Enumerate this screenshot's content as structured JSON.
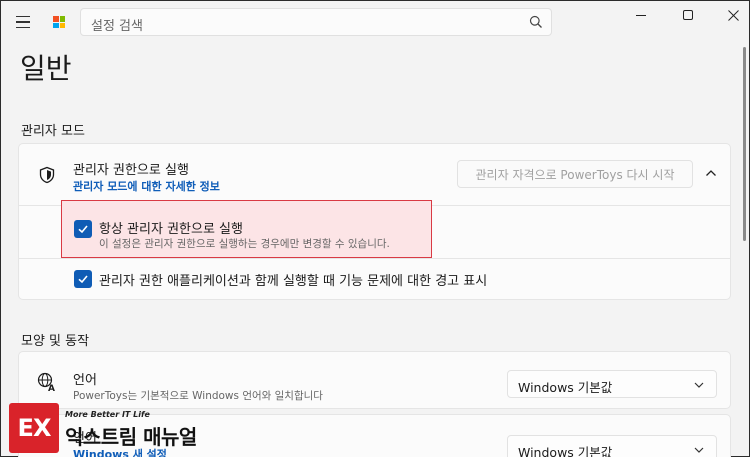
{
  "search": {
    "placeholder": "설정 검색"
  },
  "page": {
    "title": "일반"
  },
  "sections": {
    "admin_mode": "관리자 모드",
    "appearance": "모양 및 동작"
  },
  "admin": {
    "row_title": "관리자 권한으로 실행",
    "row_link": "관리자 모드에 대한 자세한 정보",
    "restart_button": "관리자 자격으로 PowerToys 다시 시작",
    "always_admin": {
      "label": "항상 관리자 권한으로 실행",
      "description": "이 설정은 관리자 권한으로 실행하는 경우에만 변경할 수 있습니다.",
      "checked": true
    },
    "warn_admin": {
      "label": "관리자 권한 애플리케이션과 함께 실행할 때 기능 문제에 대한 경고 표시",
      "checked": true
    }
  },
  "language": {
    "title": "언어",
    "description": "PowerToys는 기본적으로 Windows 언어와 일치합니다",
    "selected": "Windows 기본값"
  },
  "language2": {
    "title": "언어",
    "link": "Windows 새 설정",
    "selected": "Windows 기본값"
  },
  "watermark": {
    "logo": "EX",
    "tagline": "More Better IT Life",
    "name": "익스트림 매뉴얼"
  },
  "colors": {
    "accent": "#0f5cb5",
    "highlight_border": "#d93a44",
    "highlight_fill": "#fce4e6",
    "watermark_red": "#d9232a"
  }
}
